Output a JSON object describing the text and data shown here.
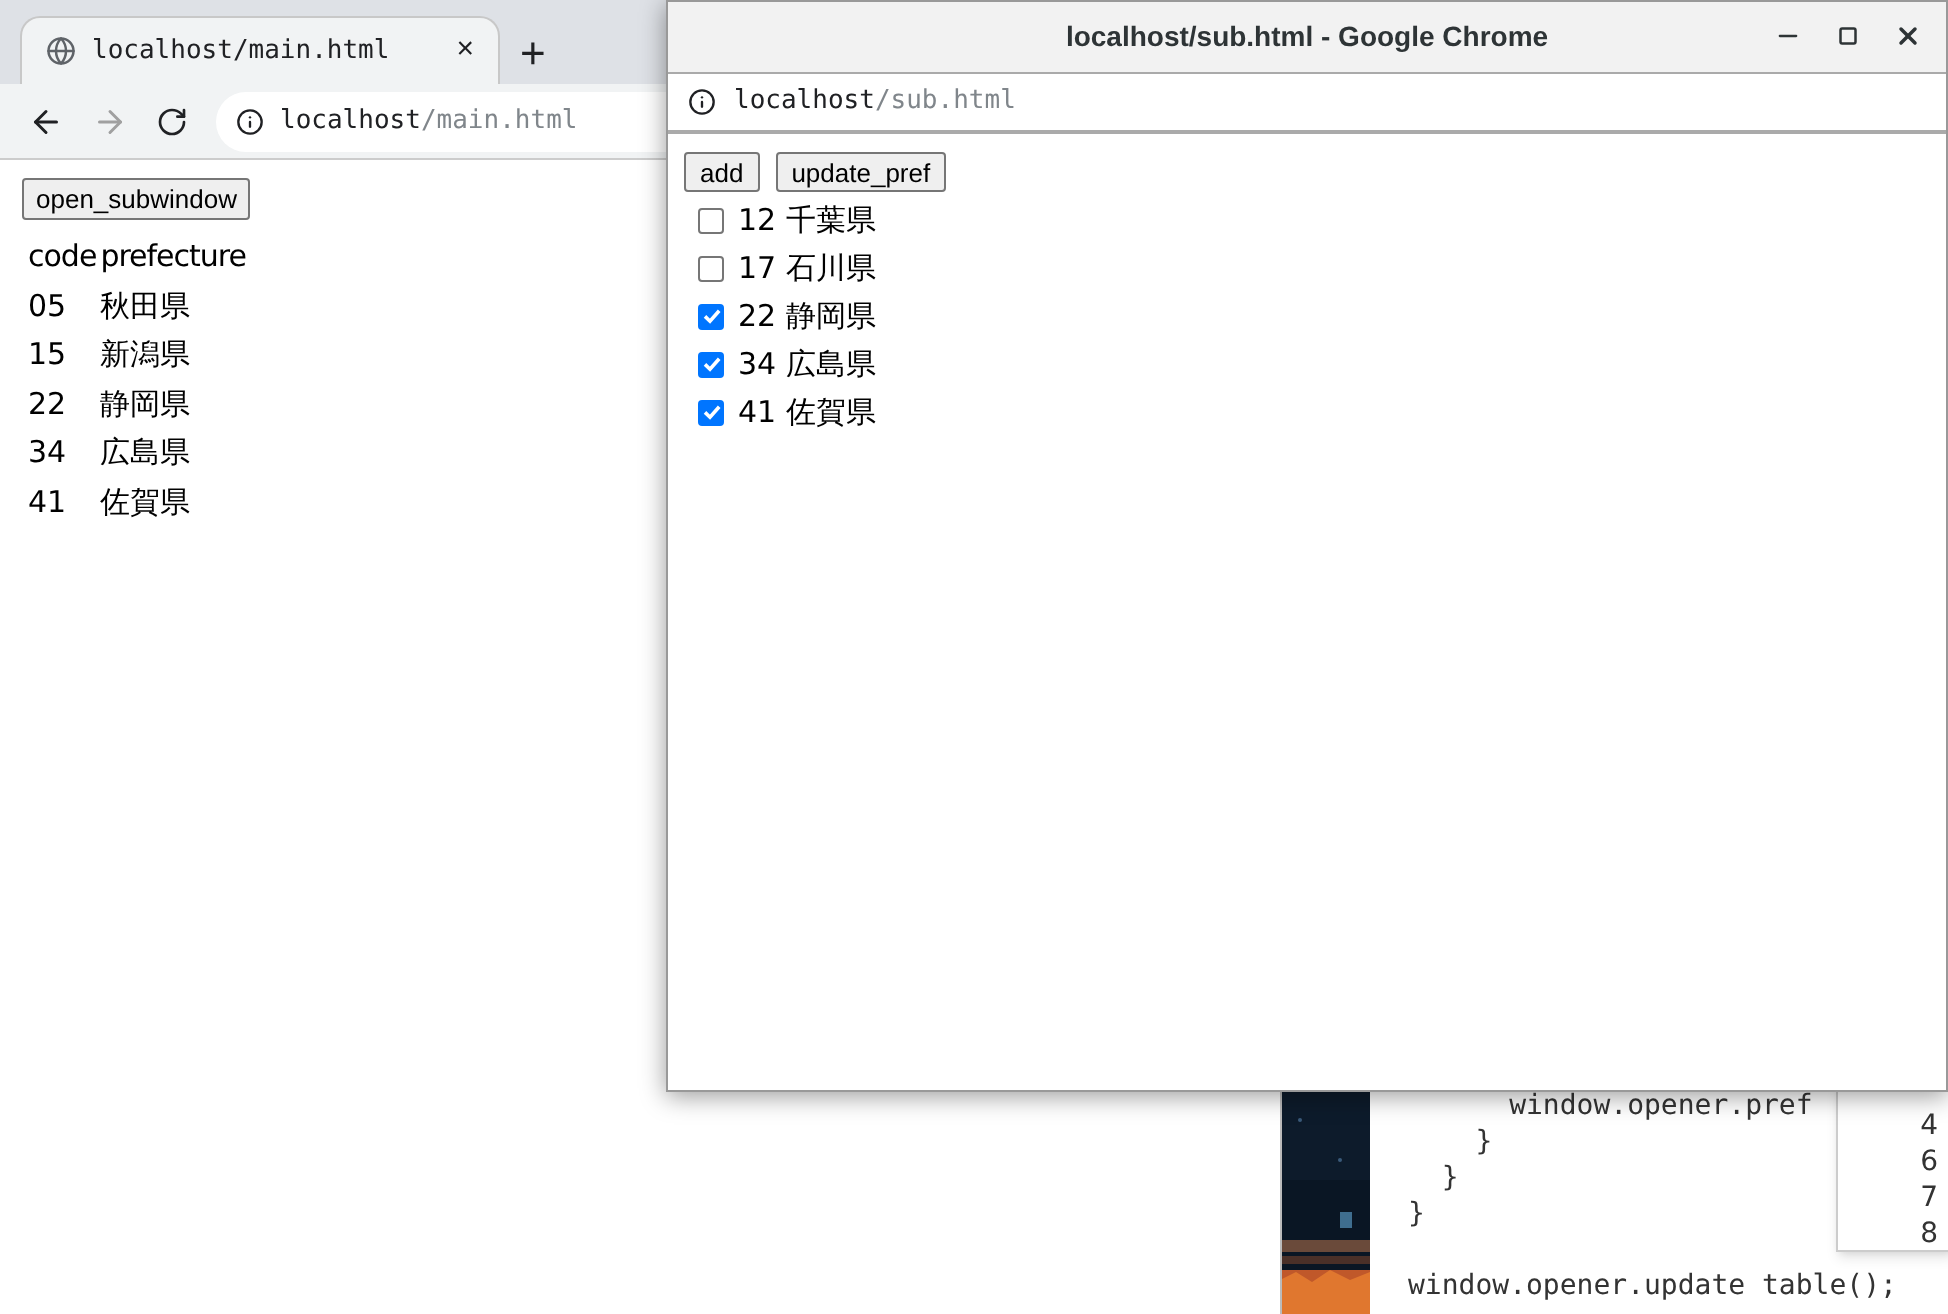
{
  "main_window": {
    "tab": {
      "title": "localhost/main.html",
      "close": "×"
    },
    "new_tab": "+",
    "address": {
      "host": "localhost",
      "path": "/main.html"
    },
    "button": "open_subwindow",
    "table": {
      "columns": [
        "code",
        "prefecture"
      ],
      "rows": [
        [
          "05",
          "秋田県"
        ],
        [
          "15",
          "新潟県"
        ],
        [
          "22",
          "静岡県"
        ],
        [
          "34",
          "広島県"
        ],
        [
          "41",
          "佐賀県"
        ]
      ]
    }
  },
  "sub_window": {
    "title": "localhost/sub.html - Google Chrome",
    "address": {
      "host": "localhost",
      "path": "/sub.html"
    },
    "buttons": [
      "add",
      "update_pref"
    ],
    "items": [
      {
        "code": "12",
        "name": "千葉県",
        "checked": false
      },
      {
        "code": "17",
        "name": "石川県",
        "checked": false
      },
      {
        "code": "22",
        "name": "静岡県",
        "checked": true
      },
      {
        "code": "34",
        "name": "広島県",
        "checked": true
      },
      {
        "code": "41",
        "name": "佐賀県",
        "checked": true
      }
    ]
  },
  "editor": {
    "blocks": [
      [
        "      window.opener.pref",
        "    }",
        "  }",
        "}"
      ],
      [
        "window.opener.update table();"
      ]
    ]
  },
  "side_panel": {
    "numbers": [
      "4",
      "6",
      "7",
      "8"
    ]
  }
}
